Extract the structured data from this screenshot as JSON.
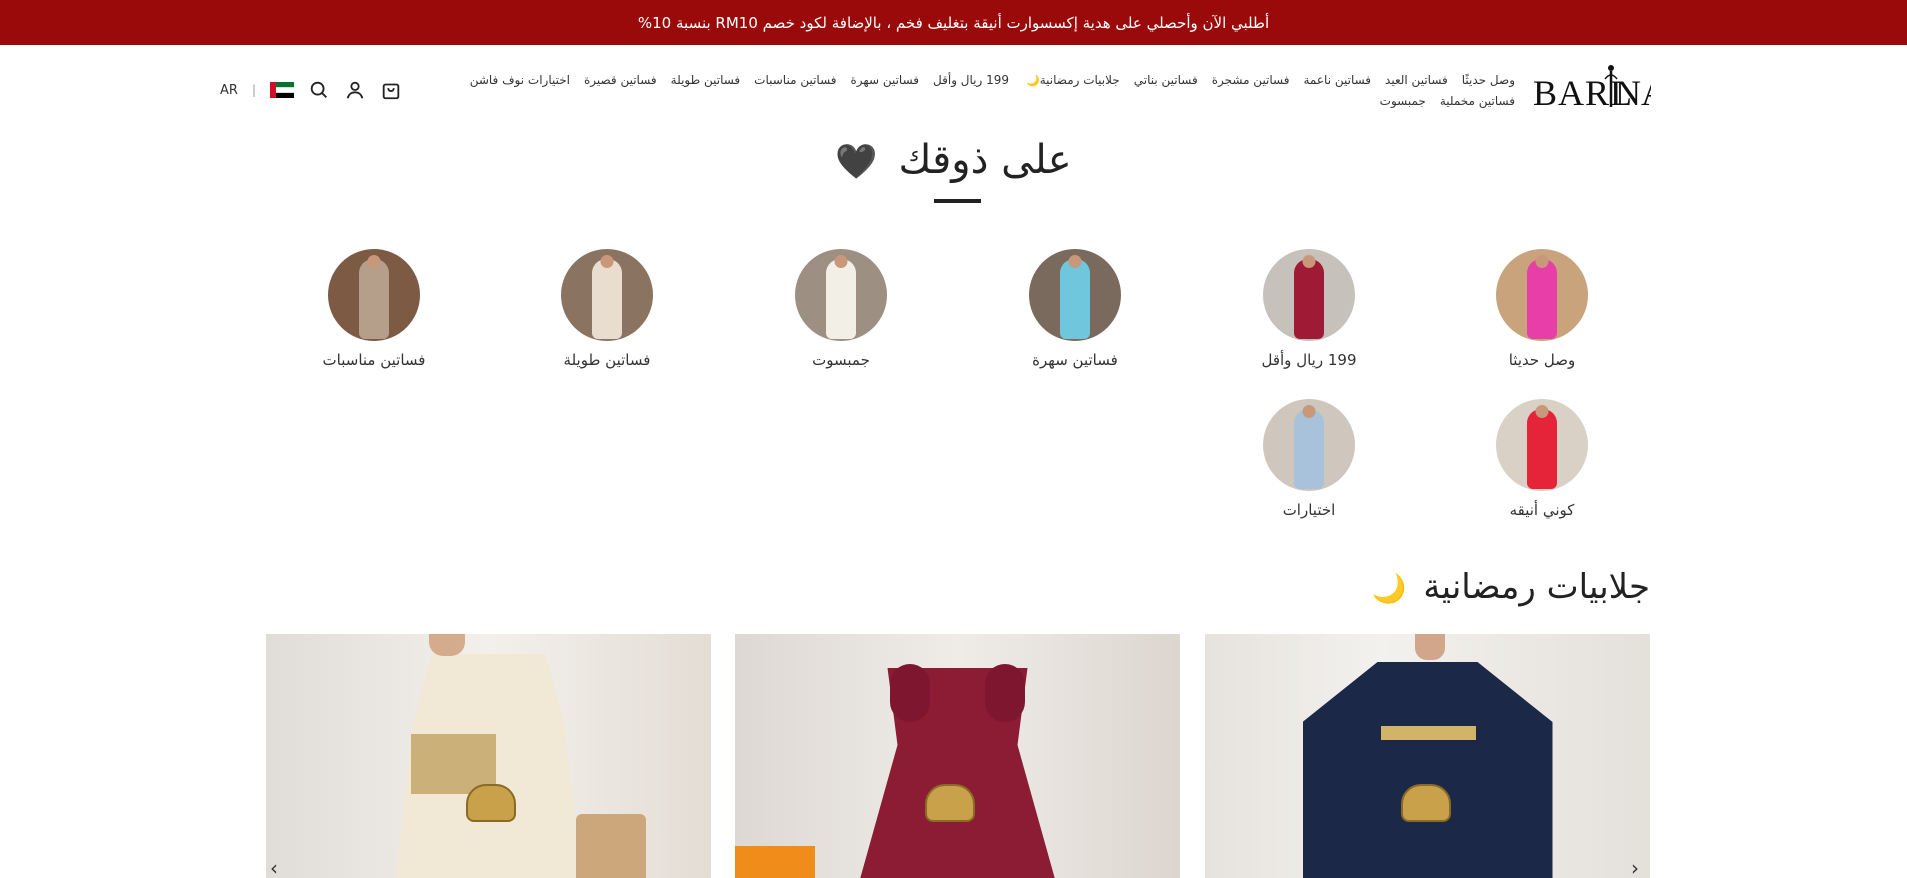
{
  "announcement": "أطلبي الآن وأحصلي على هدية إكسسوارت أنيقة بتغليف فخم ، بالإضافة لكود خصم RM10 بنسبة 10%",
  "logo_text": "BARLINA",
  "nav": {
    "row1": [
      "وصل حديثًا",
      "فساتين العيد",
      "فساتين ناعمة",
      "فساتين مشجرة",
      "فساتين بناتي",
      "جلابيات رمضانية",
      "199 ريال وأقل",
      "فساتين سهرة",
      "فساتين مناسبات",
      "فساتين طويلة",
      "فساتين قصيرة",
      "اختيارات نوف فاشن"
    ],
    "row2": [
      "فساتين مخملية",
      "جمبسوت"
    ]
  },
  "utility": {
    "lang": "AR",
    "sep": "|",
    "icons": [
      "uae-flag-icon",
      "search-icon",
      "account-icon",
      "cart-icon"
    ]
  },
  "section_title": "على ذوقك",
  "section_heart": "🖤",
  "categories": [
    {
      "label": "وصل حديثا",
      "color": "#e83ea8"
    },
    {
      "label": "199 ريال وأقل",
      "color": "#9e1a35"
    },
    {
      "label": "فساتين سهرة",
      "color": "#6fc7dd"
    },
    {
      "label": "جمبسوت",
      "color": "#f2efe7"
    },
    {
      "label": "فساتين طويلة",
      "color": "#e8ddce"
    },
    {
      "label": "فساتين مناسبات",
      "color": "#b59f8a"
    },
    {
      "label": "كوني أنيقه",
      "color": "#e5243a"
    },
    {
      "label": "اختيارات",
      "color": "#a8c2dc"
    }
  ],
  "ramadan_title": "جلابيات رمضانية",
  "ramadan_moon": "🌙",
  "products": [
    {
      "name": "navy-embroidered-jalabiya",
      "color": "#1c2848",
      "accent": "#d2b36a"
    },
    {
      "name": "burgundy-puff-sleeve-dress",
      "color": "#8c1b34",
      "accent": "#d2a04a"
    },
    {
      "name": "cream-embroidered-dress",
      "color": "#f1e8d6",
      "accent": "#cbb07a"
    }
  ],
  "arrows": {
    "prev": "‹",
    "next": "›"
  }
}
